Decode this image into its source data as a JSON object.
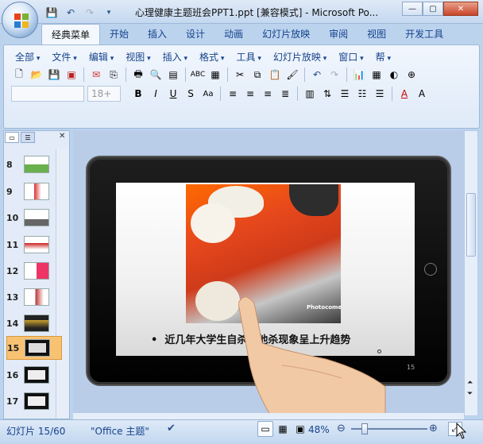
{
  "window": {
    "title": "心理健康主题班会PPT1.ppt [兼容模式] - Microsoft Po..."
  },
  "tabs": [
    "经典菜单",
    "开始",
    "插入",
    "设计",
    "动画",
    "幻灯片放映",
    "审阅",
    "视图",
    "开发工具"
  ],
  "active_tab_index": 0,
  "menu": [
    "全部",
    "文件",
    "编辑",
    "视图",
    "插入",
    "格式",
    "工具",
    "幻灯片放映",
    "窗口",
    "帮"
  ],
  "toolbar": {
    "font_size_placeholder": "18+"
  },
  "thumbnails": [
    {
      "num": "8"
    },
    {
      "num": "9"
    },
    {
      "num": "10"
    },
    {
      "num": "11"
    },
    {
      "num": "12"
    },
    {
      "num": "13"
    },
    {
      "num": "14"
    },
    {
      "num": "15"
    },
    {
      "num": "16"
    },
    {
      "num": "17"
    }
  ],
  "selected_thumbnail": "15",
  "slide": {
    "bullet_text": "近几年大学生自杀和他杀现象呈上升趋势",
    "watermark": "Photocome",
    "page_mark": "15"
  },
  "status": {
    "slide_indicator": "幻灯片 15/60",
    "theme": "\"Office 主题\"",
    "zoom": "48%"
  },
  "colors": {
    "accent": "#15428b",
    "selected_thumb": "#f8c273"
  }
}
